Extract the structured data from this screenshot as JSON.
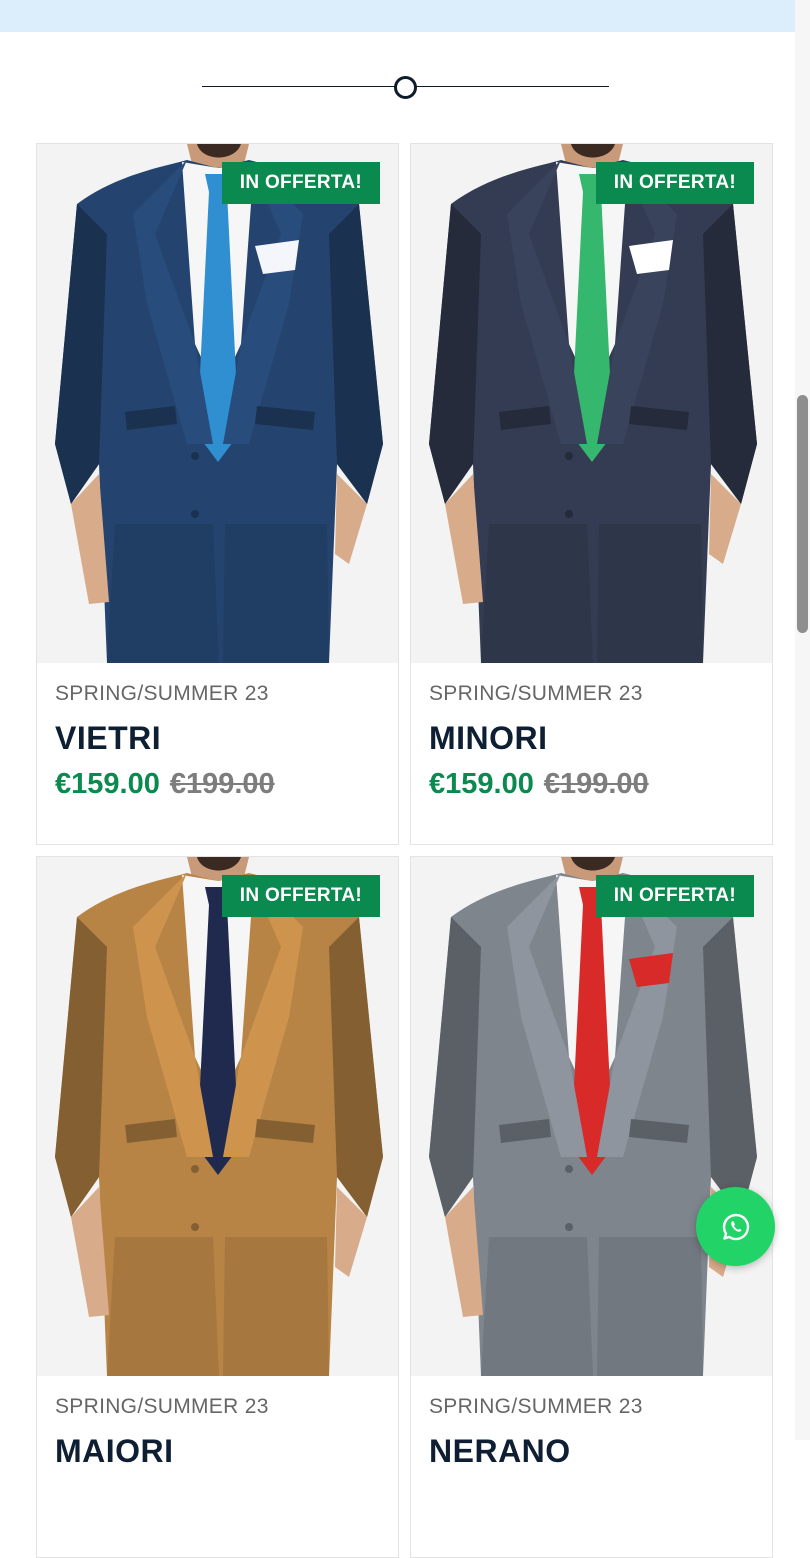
{
  "products": [
    {
      "collection": "SPRING/SUMMER 23",
      "name": "VIETRI",
      "sale_price": "€159.00",
      "regular_price": "€199.00",
      "badge": "IN OFFERTA!",
      "suit_color": "#24446f",
      "tie_color": "#2f8fd0",
      "pocket_color": "#f4f6fb"
    },
    {
      "collection": "SPRING/SUMMER 23",
      "name": "MINORI",
      "sale_price": "€159.00",
      "regular_price": "€199.00",
      "badge": "IN OFFERTA!",
      "suit_color": "#333c52",
      "tie_color": "#35b86d",
      "pocket_color": "#ffffff"
    },
    {
      "collection": "SPRING/SUMMER 23",
      "name": "MAIORI",
      "sale_price": "",
      "regular_price": "",
      "badge": "IN OFFERTA!",
      "suit_color": "#b88446",
      "tie_color": "#1f2a4e",
      "pocket_color": ""
    },
    {
      "collection": "SPRING/SUMMER 23",
      "name": "NERANO",
      "sale_price": "",
      "regular_price": "",
      "badge": "IN OFFERTA!",
      "suit_color": "#7f858d",
      "tie_color": "#d92a2a",
      "pocket_color": "#d92a2a"
    }
  ],
  "colors": {
    "banner": "#dcedfc",
    "accent_green": "#0a8a4f",
    "title_navy": "#0e1f33",
    "whatsapp_green": "#22d367"
  },
  "whatsapp": {
    "icon": "whatsapp-icon"
  }
}
